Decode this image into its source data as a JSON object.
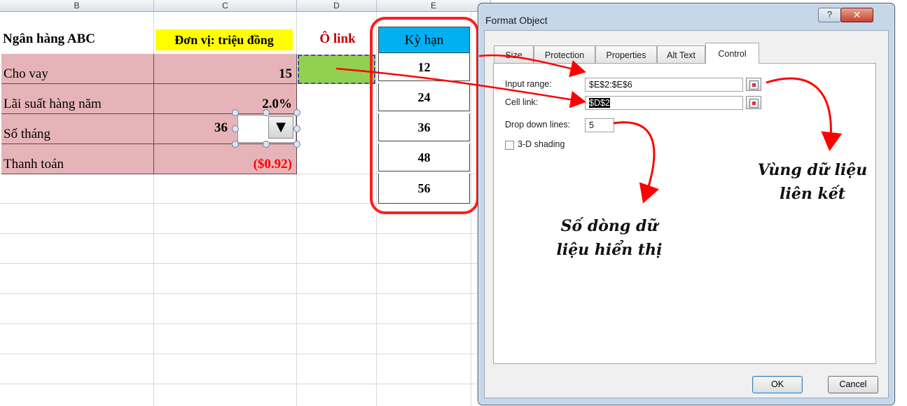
{
  "sheet": {
    "columns": [
      "B",
      "C",
      "D",
      "E"
    ],
    "title": "Ngân hàng ABC",
    "unit": "Đơn vị: triệu đồng",
    "link_header": "Ô link",
    "term_header": "Kỳ hạn",
    "rows": [
      {
        "label": "Cho vay",
        "value": "15"
      },
      {
        "label": "Lãi suất hàng năm",
        "value": "2.0%"
      },
      {
        "label": "Số tháng",
        "value": "36"
      },
      {
        "label": "Thanh toán",
        "value": "($0.92)"
      }
    ],
    "terms": [
      "12",
      "24",
      "36",
      "48",
      "56"
    ],
    "combo_arrow": "▼",
    "colors": {
      "unit_bg": "#ffff00",
      "pink": "#e6b4b8",
      "link_cell": "#92d050",
      "term_header_bg": "#00b0f0",
      "link_text": "#c00000",
      "payment_text": "#ff0000"
    }
  },
  "dialog": {
    "title": "Format Object",
    "help_label": "?",
    "close_label": "✕",
    "tabs": [
      "Size",
      "Protection",
      "Properties",
      "Alt Text",
      "Control"
    ],
    "active_tab": "Control",
    "input_range_label": "Input range:",
    "input_range_value": "$E$2:$E$6",
    "cell_link_label": "Cell link:",
    "cell_link_value": "$D$2",
    "drop_lines_label": "Drop down lines:",
    "drop_lines_value": "5",
    "shading_label": "3-D shading",
    "shading_checked": false,
    "ok_label": "OK",
    "cancel_label": "Cancel"
  },
  "annotations": {
    "linked_range": [
      "Vùng dữ liệu",
      "liên kết"
    ],
    "display_rows": [
      "Số dòng dữ",
      "liệu hiển thị"
    ],
    "color": "#ff0000"
  }
}
